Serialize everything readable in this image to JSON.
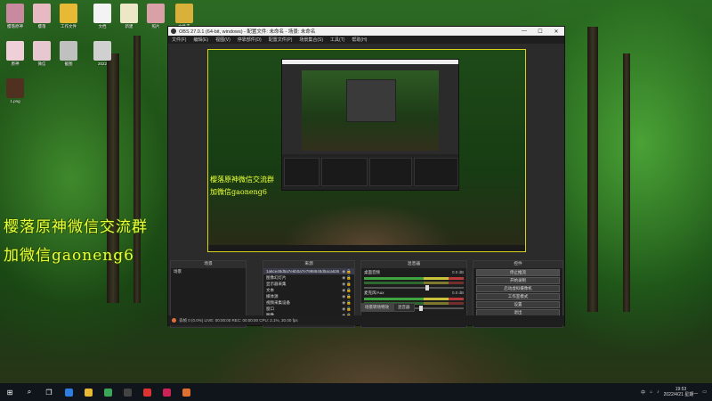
{
  "desktop": {
    "icons": [
      {
        "label": "樱落原神",
        "color": "#c98aa0"
      },
      {
        "label": "樱落",
        "color": "#e7b9c2"
      },
      {
        "label": "工作文件",
        "color": "#e8b934"
      },
      {
        "label": "文档",
        "color": "#f3f3f3"
      },
      {
        "label": "新建",
        "color": "#ede7c8"
      },
      {
        "label": "照片",
        "color": "#d9a0a8"
      },
      {
        "label": "文件夹",
        "color": "#d9b03a"
      },
      {
        "label": "原神",
        "color": "#f0d0d8"
      },
      {
        "label": "微信",
        "color": "#e8c8d0"
      },
      {
        "label": "截图",
        "color": "#c0c0c0"
      },
      {
        "label": "2022",
        "color": "#d0d0d0"
      },
      {
        "label": "1.png",
        "color": "#503020"
      }
    ],
    "overlay_line1": "樱落原神微信交流群",
    "overlay_line2": "加微信gaoneng6"
  },
  "obs": {
    "title": "OBS 27.0.1 (64-bit, windows) - 配置文件: 未命名 - 场景: 未命名",
    "window_controls": [
      "—",
      "☐",
      "✕"
    ],
    "menu": [
      "文件(F)",
      "编辑(E)",
      "视图(V)",
      "停靠部件(D)",
      "配置文件(P)",
      "场景集合(S)",
      "工具(T)",
      "帮助(H)"
    ],
    "preview_overlay_line1": "樱落原神微信交流群",
    "preview_overlay_line2": "加微信gaoneng6",
    "docks": {
      "scenes": {
        "header": "场景",
        "items": [
          "场景"
        ]
      },
      "sources": {
        "header": "来源",
        "items": [
          "1a6ce48d5a7e6b0a7e7998848d5aca636",
          "图像幻灯片",
          "显示器采集",
          "文本",
          "媒体源",
          "视频采集设备",
          "窗口",
          "图像"
        ]
      },
      "mixer": {
        "header": "混音器",
        "channels": [
          {
            "name": "桌面音频",
            "db": "0.0 dB",
            "level": 0.62
          },
          {
            "name": "麦克风/Aux",
            "db": "0.0 dB",
            "level": 0.55
          }
        ]
      },
      "transitions": {
        "header": "转场特效"
      },
      "controls": {
        "header": "控件",
        "buttons": [
          "停止推流",
          "开始录制",
          "启动虚拟摄像机",
          "工作室模式",
          "设置",
          "退出"
        ]
      }
    },
    "tabs": [
      "场景转场特效",
      "混音器"
    ],
    "status": "丢帧 0 (0.0%)   LIVE: 00:00:00   REC: 00:00:00   CPU: 2.1%, 30.00 fps"
  },
  "taskbar": {
    "apps": [
      {
        "name": "start-icon",
        "glyph": "⊞"
      },
      {
        "name": "search-icon",
        "glyph": "⌕"
      },
      {
        "name": "task-view-icon",
        "glyph": "❐"
      },
      {
        "name": "edge-icon",
        "color": "#2f7de0"
      },
      {
        "name": "explorer-icon",
        "color": "#e8b934"
      },
      {
        "name": "chrome-icon",
        "color": "#3aa757"
      },
      {
        "name": "obs-icon",
        "color": "#444"
      },
      {
        "name": "netease-icon",
        "color": "#d33"
      },
      {
        "name": "genshin-icon",
        "color": "#c25"
      },
      {
        "name": "app-icon",
        "color": "#e07030"
      }
    ],
    "tray": {
      "ime": "中",
      "time": "19:53",
      "date": "2022/4/21 星期一"
    }
  }
}
